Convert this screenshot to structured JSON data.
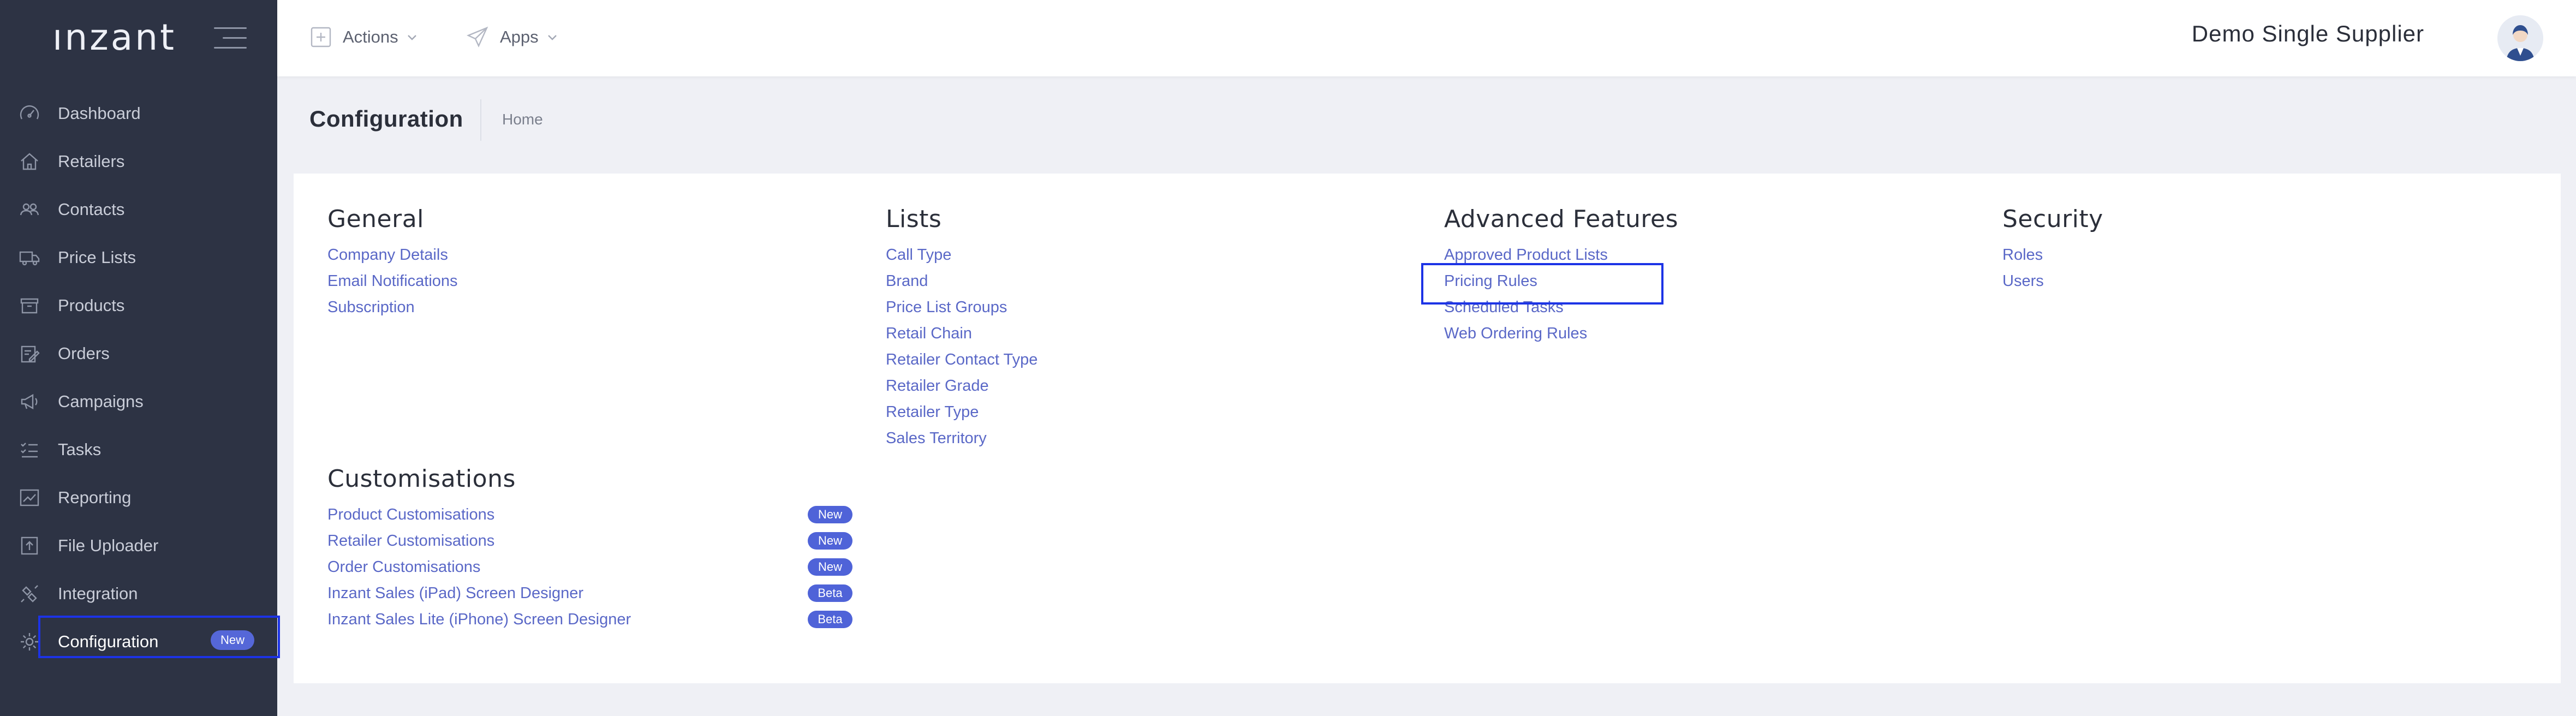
{
  "app": {
    "logo": "ınzant"
  },
  "sidebar": {
    "items": [
      {
        "label": "Dashboard",
        "icon": "dashboard-icon"
      },
      {
        "label": "Retailers",
        "icon": "home-icon"
      },
      {
        "label": "Contacts",
        "icon": "contacts-icon"
      },
      {
        "label": "Price Lists",
        "icon": "truck-icon"
      },
      {
        "label": "Products",
        "icon": "box-icon"
      },
      {
        "label": "Orders",
        "icon": "clipboard-edit-icon"
      },
      {
        "label": "Campaigns",
        "icon": "megaphone-icon"
      },
      {
        "label": "Tasks",
        "icon": "tasks-icon"
      },
      {
        "label": "Reporting",
        "icon": "chart-icon"
      },
      {
        "label": "File Uploader",
        "icon": "upload-icon"
      },
      {
        "label": "Integration",
        "icon": "integration-icon"
      },
      {
        "label": "Configuration",
        "icon": "gear-icon",
        "badge": "New",
        "active": true
      }
    ]
  },
  "topbar": {
    "actions_label": "Actions",
    "apps_label": "Apps",
    "company": "Demo Single Supplier"
  },
  "page": {
    "title": "Configuration",
    "breadcrumb": "Home"
  },
  "sections": {
    "general": {
      "title": "General",
      "links": [
        "Company Details",
        "Email Notifications",
        "Subscription"
      ]
    },
    "lists": {
      "title": "Lists",
      "links": [
        "Call Type",
        "Brand",
        "Price List Groups",
        "Retail Chain",
        "Retailer Contact Type",
        "Retailer Grade",
        "Retailer Type",
        "Sales Territory"
      ]
    },
    "advanced": {
      "title": "Advanced Features",
      "links": [
        "Approved Product Lists",
        "Pricing Rules",
        "Scheduled Tasks",
        "Web Ordering Rules"
      ]
    },
    "security": {
      "title": "Security",
      "links": [
        "Roles",
        "Users"
      ]
    },
    "customisations": {
      "title": "Customisations",
      "items": [
        {
          "label": "Product Customisations",
          "badge": "New"
        },
        {
          "label": "Retailer Customisations",
          "badge": "New"
        },
        {
          "label": "Order Customisations",
          "badge": "New"
        },
        {
          "label": "Inzant Sales (iPad) Screen Designer",
          "badge": "Beta"
        },
        {
          "label": "Inzant Sales Lite (iPhone) Screen Designer",
          "badge": "Beta"
        }
      ]
    }
  },
  "colors": {
    "sidebar_bg": "#2d3344",
    "link": "#5a68c7",
    "badge": "#4f63d8",
    "highlight": "#1c33e6"
  }
}
